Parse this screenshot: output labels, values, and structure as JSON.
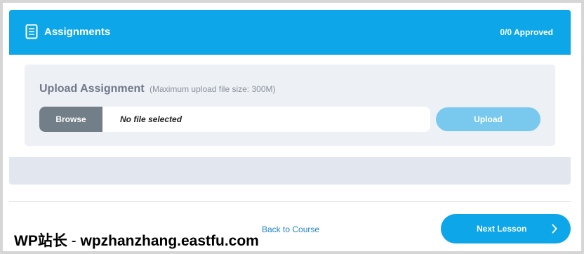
{
  "assignments": {
    "title": "Assignments",
    "status": "0/0 Approved",
    "icon": "document-icon"
  },
  "upload": {
    "heading": "Upload Assignment",
    "hint": "(Maximum upload file size: 300M)",
    "browse_label": "Browse",
    "file_value": "No file selected",
    "upload_label": "Upload"
  },
  "footer": {
    "back_label": "Back to Course",
    "next_label": "Next Lesson",
    "next_icon": "chevron-right-icon"
  },
  "watermark": {
    "brand": "WP站长",
    "separator": " - ",
    "domain": "wpzhanzhang.eastfu.com"
  },
  "colors": {
    "accent": "#0da6e8",
    "upload_disabled": "#79c9ef",
    "browse": "#727e88"
  }
}
